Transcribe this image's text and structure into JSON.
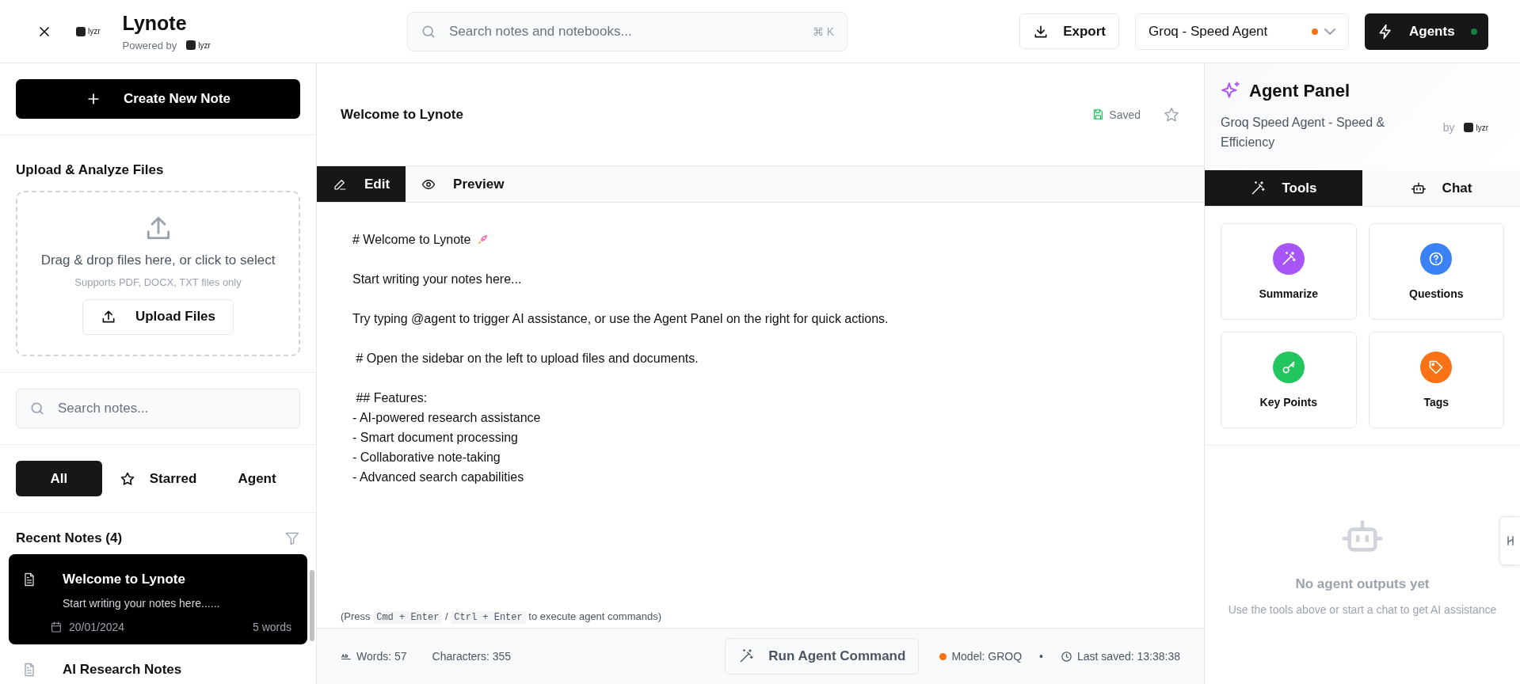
{
  "header": {
    "app_title": "Lynote",
    "logo_text": "lyzr",
    "powered_by": "Powered by",
    "powered_logo_text": "lyzr",
    "search": {
      "placeholder": "Search notes and notebooks...",
      "shortcut": "⌘ K"
    },
    "export_button": "Export",
    "agent_select": {
      "value": "Groq - Speed Agent"
    },
    "agents_button": "Agents"
  },
  "sidebar": {
    "create_button": "Create New Note",
    "upload": {
      "title": "Upload & Analyze Files",
      "drop_text": "Drag & drop files here, or click to select",
      "hint": "Supports PDF, DOCX, TXT files only",
      "button": "Upload Files"
    },
    "search": {
      "placeholder": "Search notes..."
    },
    "filters": [
      {
        "label": "All",
        "selected": true,
        "kind": "plain"
      },
      {
        "label": "Starred",
        "selected": false,
        "kind": "star"
      },
      {
        "label": "Agent",
        "selected": false,
        "kind": "plain"
      }
    ],
    "recent_title": "Recent Notes (4)",
    "notes": [
      {
        "title": "Welcome to Lynote",
        "preview": "Start writing your notes here......",
        "date": "20/01/2024",
        "words": "5 words",
        "selected": true
      },
      {
        "title": "AI Research Notes",
        "selected": false
      }
    ]
  },
  "editor": {
    "title": "Welcome to Lynote",
    "save_status": "Saved",
    "starred": false,
    "tabs": [
      {
        "label": "Edit",
        "selected": true,
        "kind": "edit"
      },
      {
        "label": "Preview",
        "selected": false,
        "kind": "preview"
      }
    ],
    "paragraphs": [
      [
        "# Welcome to Lynote"
      ],
      [
        "Start writing your notes here..."
      ],
      [
        "Try typing @agent to trigger AI assistance, or use the Agent Panel on the right for quick actions."
      ],
      [
        " # Open the sidebar on the left to upload files and documents."
      ],
      [
        " ## Features:",
        "- AI-powered research assistance",
        "- Smart document processing",
        "- Collaborative note-taking",
        "- Advanced search capabilities"
      ]
    ],
    "hint": {
      "before": "(Press",
      "keys": [
        "Cmd + Enter",
        "Ctrl + Enter"
      ],
      "separator": "/",
      "after": "to execute agent commands)"
    },
    "footer": {
      "words": "Words: 57",
      "characters": "Characters: 355",
      "run_button": "Run Agent Command",
      "model": "Model: GROQ",
      "separator": "•",
      "last_saved": "Last saved: 13:38:38"
    }
  },
  "agent_panel": {
    "title": "Agent Panel",
    "subtitle": "Groq Speed Agent - Speed & Efficiency",
    "by": "by",
    "logo_text": "lyzr",
    "tabs": [
      {
        "label": "Tools",
        "selected": true,
        "kind": "tools"
      },
      {
        "label": "Chat",
        "selected": false,
        "kind": "chat"
      }
    ],
    "tools": [
      {
        "label": "Summarize",
        "kind": "wand",
        "color": "#a855f7"
      },
      {
        "label": "Questions",
        "kind": "question",
        "color": "#3b82f6"
      },
      {
        "label": "Key Points",
        "kind": "key",
        "color": "#22c55e"
      },
      {
        "label": "Tags",
        "kind": "tag",
        "color": "#f97316"
      }
    ],
    "empty_title": "No agent outputs yet",
    "empty_text": "Use the tools above or start a chat to get AI assistance"
  }
}
